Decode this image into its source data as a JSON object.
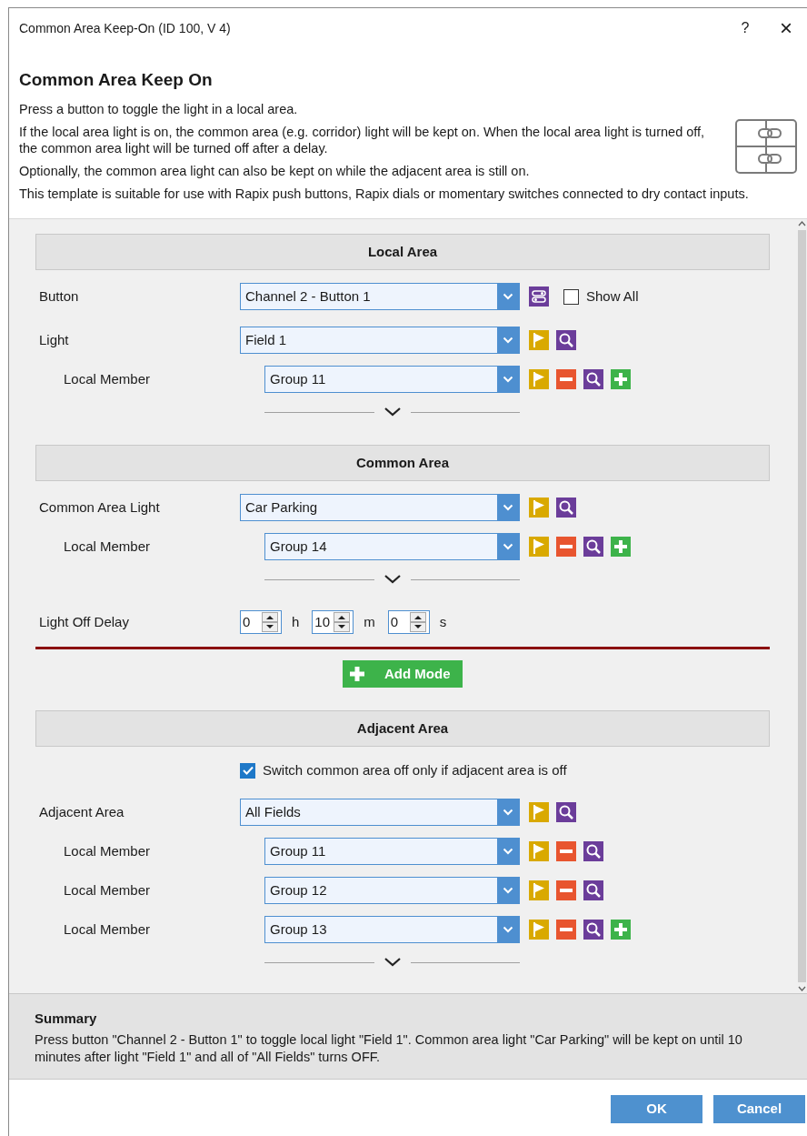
{
  "window": {
    "title": "Common Area Keep-On (ID 100, V 4)",
    "help": "?",
    "close": "×"
  },
  "header": {
    "heading": "Common Area Keep On",
    "paragraphs": [
      "Press a button to toggle the light in a local area.",
      "If the local area light is on, the common area (e.g. corridor) light will be kept on. When the local area light is turned off, the common area light will be turned off after a delay.",
      "Optionally, the common area light can also be kept on while the adjacent area is still on.",
      "This template is suitable for use with Rapix push buttons, Rapix dials or momentary switches connected to dry contact inputs."
    ]
  },
  "content": [
    {
      "kind": "section",
      "title": "Local Area",
      "items": [
        {
          "kind": "select",
          "label": "Button",
          "value": "Channel 2 - Button 1",
          "icons": [
            {
              "kind": "toggle"
            }
          ],
          "show_all": {
            "label": "Show All",
            "checked": false
          }
        },
        {
          "kind": "select",
          "label": "Light",
          "value": "Field 1",
          "icons": [
            {
              "kind": "flag"
            },
            {
              "kind": "search"
            }
          ],
          "children": [
            {
              "kind": "select",
              "label": "Local Member",
              "value": "Group 11",
              "icons": [
                {
                  "kind": "flag"
                },
                {
                  "kind": "remove"
                },
                {
                  "kind": "search"
                },
                {
                  "kind": "add"
                }
              ]
            }
          ]
        }
      ]
    },
    {
      "kind": "section",
      "title": "Common Area",
      "items": [
        {
          "kind": "select",
          "label": "Common Area Light",
          "value": "Car Parking",
          "icons": [
            {
              "kind": "flag"
            },
            {
              "kind": "search"
            }
          ],
          "children": [
            {
              "kind": "select",
              "label": "Local Member",
              "value": "Group 14",
              "icons": [
                {
                  "kind": "flag"
                },
                {
                  "kind": "remove"
                },
                {
                  "kind": "search"
                },
                {
                  "kind": "add"
                }
              ]
            }
          ]
        },
        {
          "kind": "delay",
          "label": "Light Off Delay",
          "parts": [
            {
              "value": "0",
              "unit": "h"
            },
            {
              "value": "10",
              "unit": "m"
            },
            {
              "value": "0",
              "unit": "s"
            }
          ]
        }
      ]
    },
    {
      "kind": "add_mode",
      "label": "Add Mode"
    },
    {
      "kind": "section",
      "title": "Adjacent Area",
      "items": [
        {
          "kind": "checkbox",
          "label": "Switch common area off only if adjacent area is off",
          "checked": true
        },
        {
          "kind": "select",
          "label": "Adjacent Area",
          "value": "All Fields",
          "icons": [
            {
              "kind": "flag"
            },
            {
              "kind": "search"
            }
          ],
          "children": [
            {
              "kind": "select",
              "label": "Local Member",
              "value": "Group 11",
              "icons": [
                {
                  "kind": "flag"
                },
                {
                  "kind": "remove"
                },
                {
                  "kind": "search"
                }
              ]
            },
            {
              "kind": "select",
              "label": "Local Member",
              "value": "Group 12",
              "icons": [
                {
                  "kind": "flag"
                },
                {
                  "kind": "remove"
                },
                {
                  "kind": "search"
                }
              ]
            },
            {
              "kind": "select",
              "label": "Local Member",
              "value": "Group 13",
              "icons": [
                {
                  "kind": "flag"
                },
                {
                  "kind": "remove"
                },
                {
                  "kind": "search"
                },
                {
                  "kind": "add"
                }
              ]
            }
          ]
        }
      ]
    }
  ],
  "summary": {
    "title": "Summary",
    "text": "Press button \"Channel 2 - Button 1\" to toggle local light \"Field 1\". Common area light \"Car Parking\" will be kept on until 10 minutes after light \"Field 1\" and all of \"All Fields\" turns OFF."
  },
  "buttons": [
    "OK",
    "Cancel"
  ]
}
